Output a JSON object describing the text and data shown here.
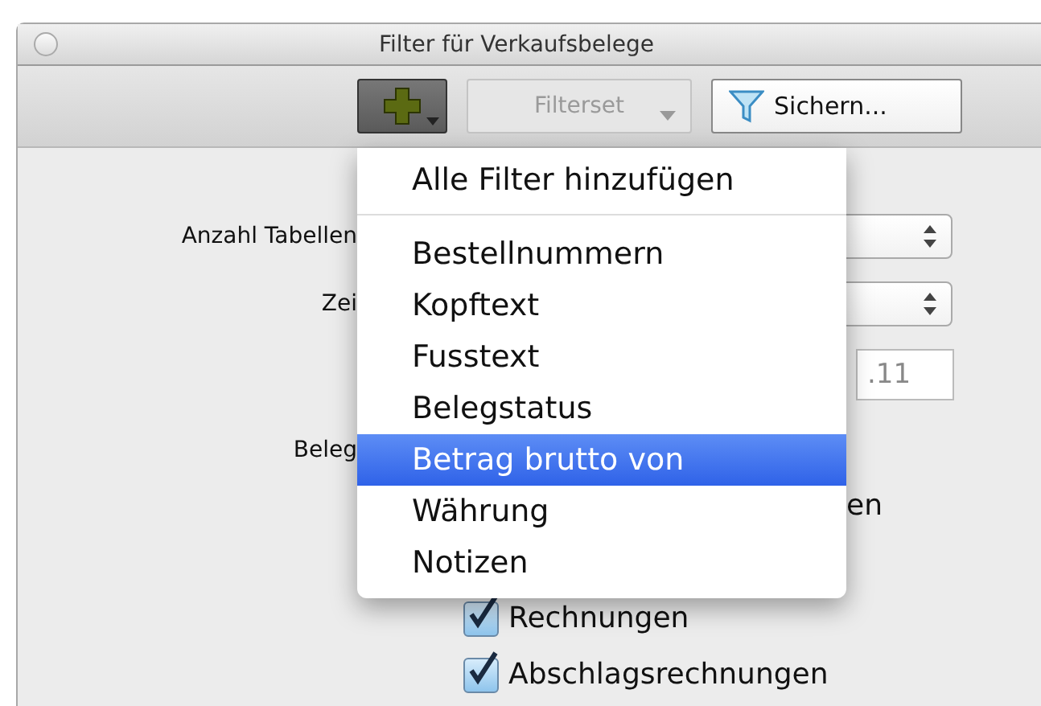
{
  "window": {
    "title": "Filter für Verkaufsbelege"
  },
  "toolbar": {
    "filterset": {
      "label": "Filterset",
      "disabled": true
    },
    "save": {
      "label": "Sichern..."
    }
  },
  "form": {
    "labels": [
      "Anzahl Tabellen",
      "Zei",
      "Beleg"
    ],
    "date_to": {
      "value": ".11"
    },
    "hidden_label_end": "en",
    "checkboxes": [
      {
        "label": "Rechnungen",
        "checked": true
      },
      {
        "label": "Abschlagsrechnungen",
        "checked": true
      }
    ]
  },
  "menu": {
    "header": "Alle Filter hinzufügen",
    "items": [
      {
        "label": "Bestellnummern",
        "selected": false
      },
      {
        "label": "Kopftext",
        "selected": false
      },
      {
        "label": "Fusstext",
        "selected": false
      },
      {
        "label": "Belegstatus",
        "selected": false
      },
      {
        "label": "Betrag brutto von",
        "selected": true
      },
      {
        "label": "Währung",
        "selected": false
      },
      {
        "label": "Notizen",
        "selected": false
      }
    ]
  }
}
